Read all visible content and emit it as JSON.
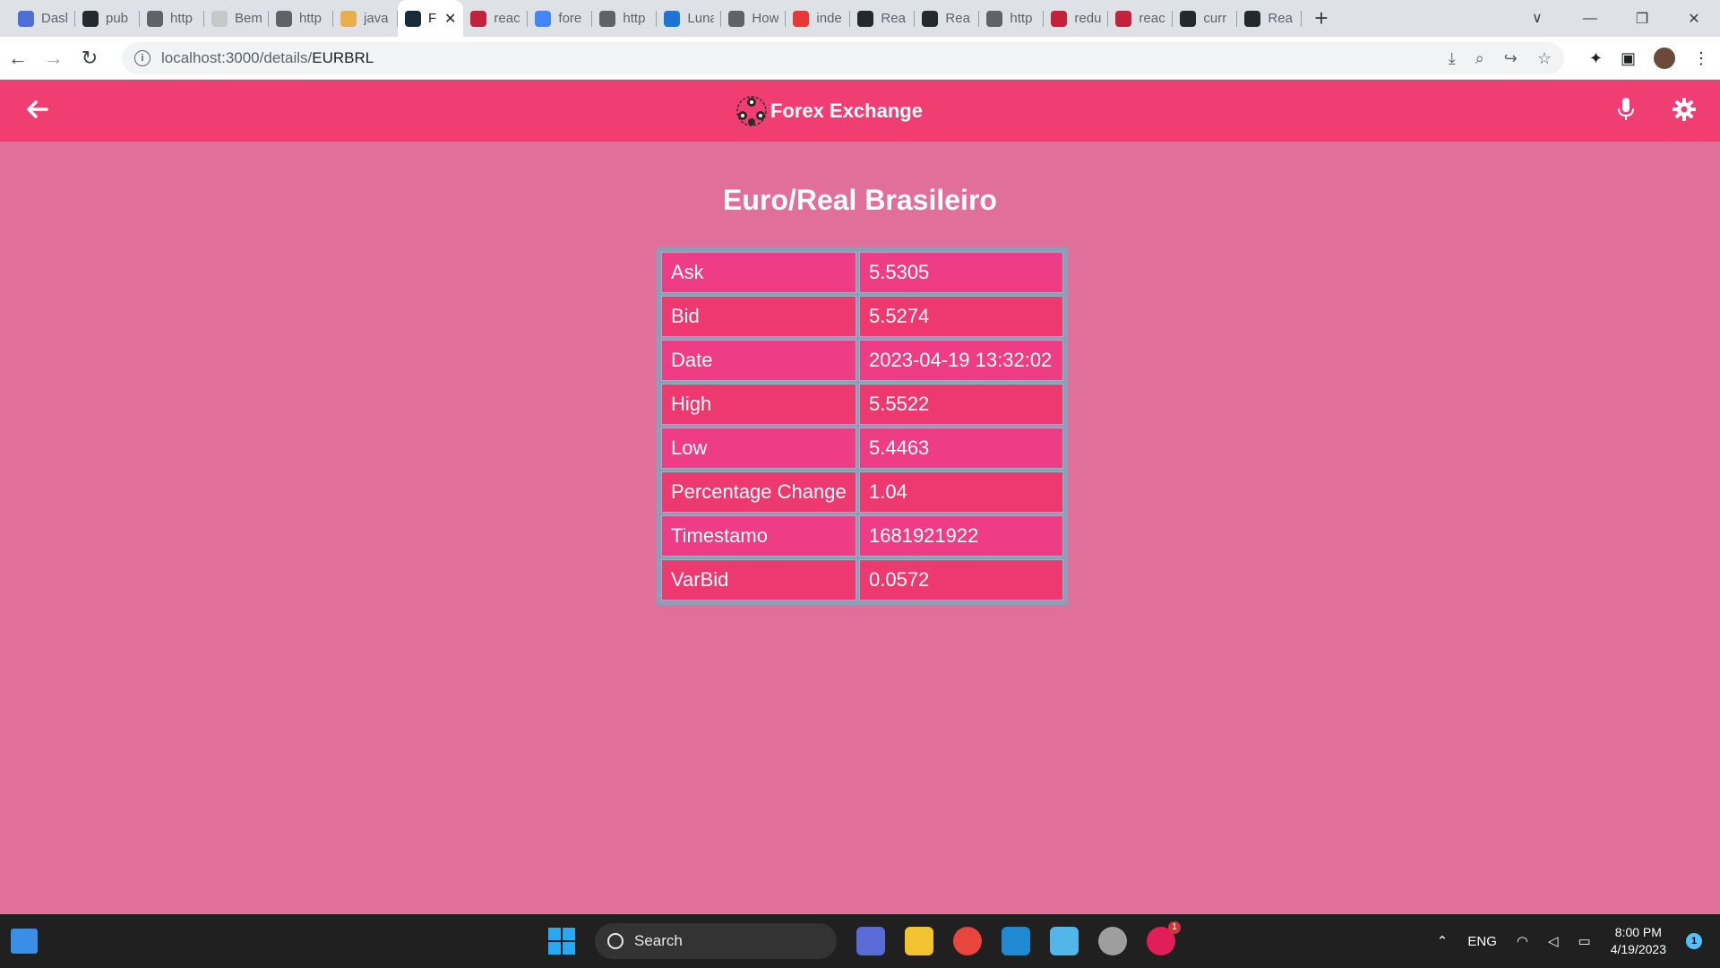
{
  "browser": {
    "tabs": [
      {
        "label": "Dasl",
        "icon": "dashboard-icon",
        "color": "#4f6fd6"
      },
      {
        "label": "pub",
        "icon": "github-icon",
        "color": "#24292e"
      },
      {
        "label": "http",
        "icon": "globe-icon",
        "color": "#5f6368"
      },
      {
        "label": "Bem",
        "icon": "loading-icon",
        "color": "#c8c8c8"
      },
      {
        "label": "http",
        "icon": "globe-icon",
        "color": "#5f6368"
      },
      {
        "label": "java",
        "icon": "pencil-icon",
        "color": "#e8b04a"
      },
      {
        "label": "F",
        "icon": "react-icon",
        "color": "#1c2b3a",
        "active": true
      },
      {
        "label": "reac",
        "icon": "n-icon",
        "color": "#c4213a"
      },
      {
        "label": "fore",
        "icon": "google-icon",
        "color": "#4285f4"
      },
      {
        "label": "http",
        "icon": "globe-icon",
        "color": "#5f6368"
      },
      {
        "label": "Luna",
        "icon": "luna-icon",
        "color": "#1976d2"
      },
      {
        "label": "How",
        "icon": "infinity-icon",
        "color": "#5f6368"
      },
      {
        "label": "inde",
        "icon": "puzzle-icon",
        "color": "#e53935"
      },
      {
        "label": "Rea",
        "icon": "github-icon",
        "color": "#24292e"
      },
      {
        "label": "Rea",
        "icon": "github-icon",
        "color": "#24292e"
      },
      {
        "label": "http",
        "icon": "globe-icon",
        "color": "#5f6368"
      },
      {
        "label": "redu",
        "icon": "n-icon",
        "color": "#c4213a"
      },
      {
        "label": "reac",
        "icon": "n-icon",
        "color": "#c4213a"
      },
      {
        "label": "curr",
        "icon": "github-icon",
        "color": "#24292e"
      },
      {
        "label": "Rea",
        "icon": "github-error-icon",
        "color": "#24292e"
      }
    ],
    "url_host": "localhost:3000/details/",
    "url_path": "EURBRL"
  },
  "app": {
    "title": "Forex Exchange",
    "accent_color": "#f03e73",
    "background_color": "#e07099"
  },
  "details": {
    "heading": "Euro/Real Brasileiro",
    "rows": [
      {
        "key": "Ask",
        "value": "5.5305"
      },
      {
        "key": "Bid",
        "value": "5.5274"
      },
      {
        "key": "Date",
        "value": "2023-04-19 13:32:02"
      },
      {
        "key": "High",
        "value": "5.5522"
      },
      {
        "key": "Low",
        "value": "5.4463"
      },
      {
        "key": "Percentage Change",
        "value": "1.04"
      },
      {
        "key": "Timestamo",
        "value": "1681921922"
      },
      {
        "key": "VarBid",
        "value": "0.0572"
      }
    ]
  },
  "taskbar": {
    "search_label": "Search",
    "language": "ENG",
    "time": "8:00 PM",
    "date": "4/19/2023",
    "notification_count": "1",
    "slack_badge": "1"
  }
}
